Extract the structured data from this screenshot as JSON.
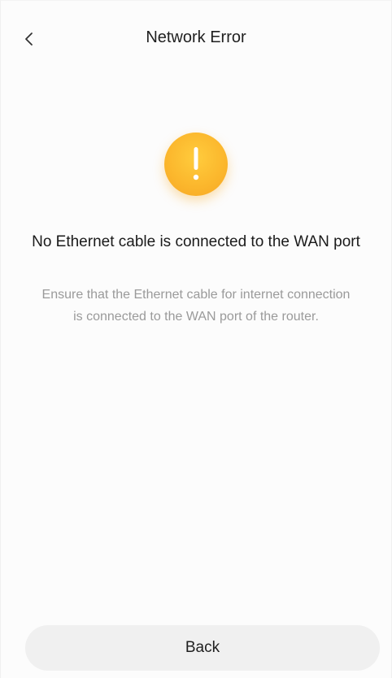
{
  "header": {
    "title": "Network Error",
    "back_icon": "chevron-left-icon"
  },
  "status": {
    "icon": "exclamation-icon",
    "icon_color": "#fbb62c",
    "headline": "No Ethernet cable is connected to the WAN port",
    "description": "Ensure that the Ethernet cable for internet connection is connected to the WAN port of the router."
  },
  "footer": {
    "back_label": "Back"
  }
}
